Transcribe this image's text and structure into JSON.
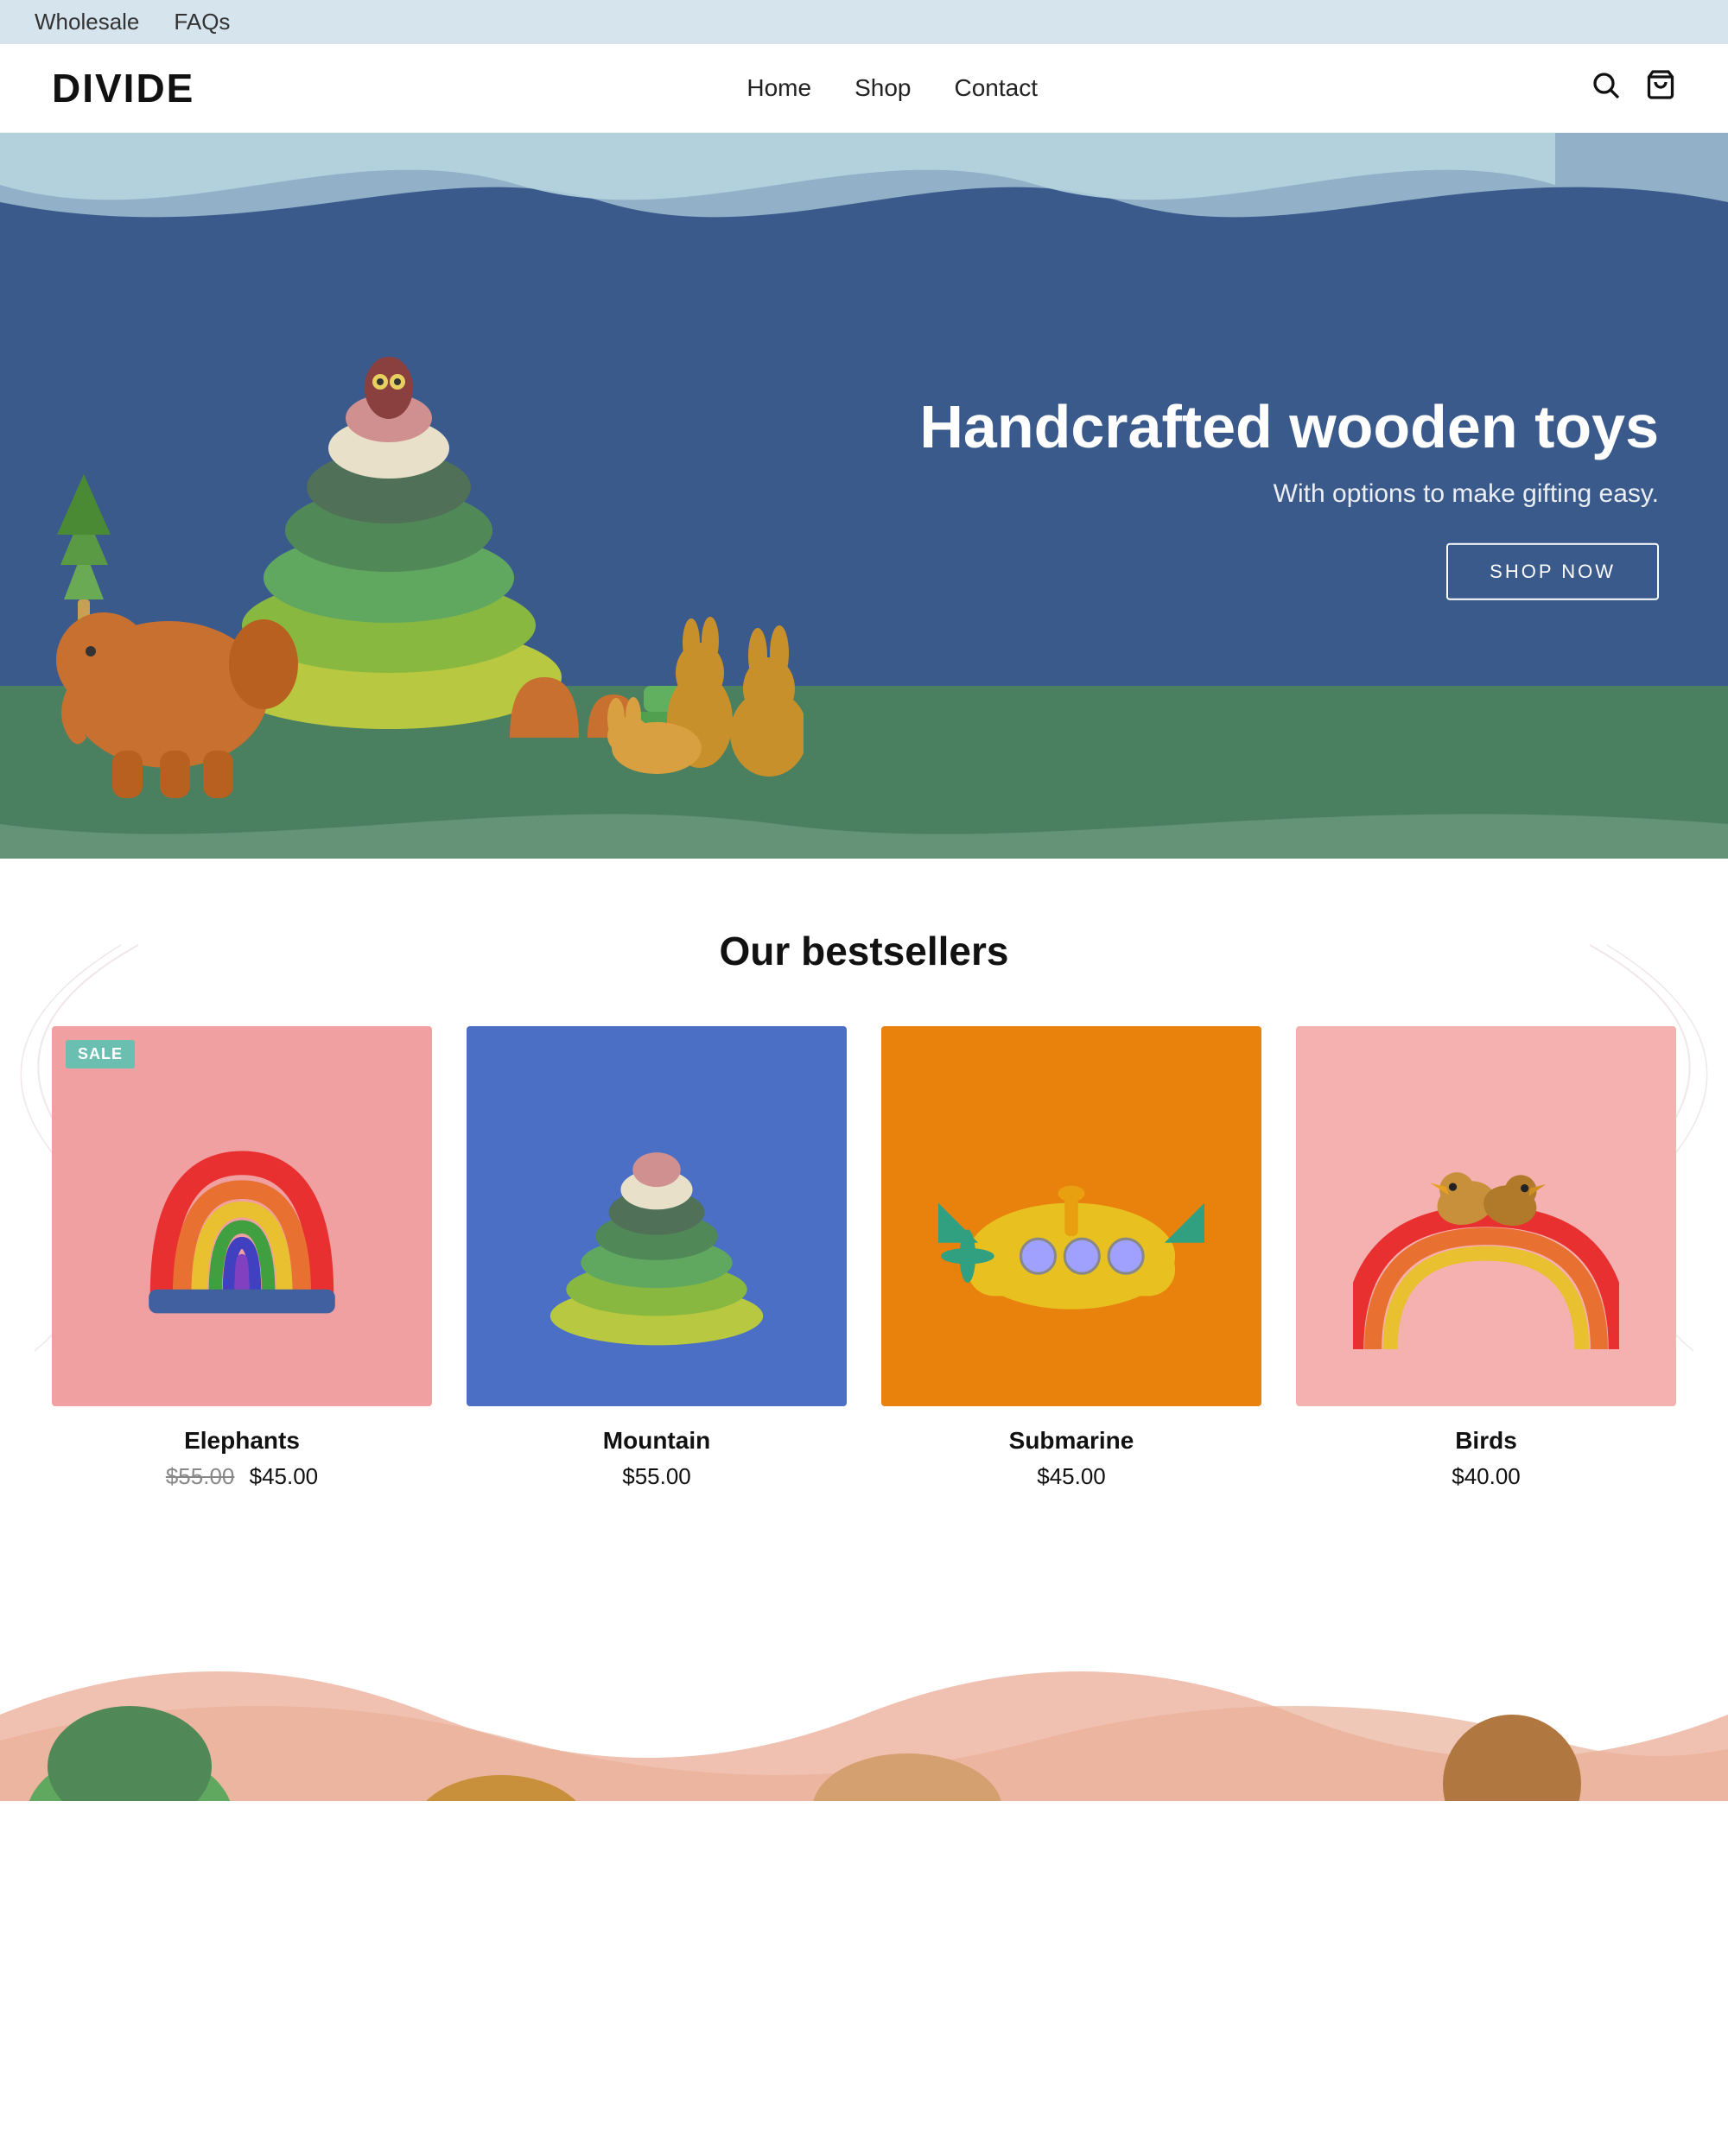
{
  "topbar": {
    "links": [
      {
        "label": "Wholesale",
        "href": "#"
      },
      {
        "label": "FAQs",
        "href": "#"
      }
    ]
  },
  "header": {
    "logo": "DIVIDE",
    "nav": [
      {
        "label": "Home",
        "href": "#"
      },
      {
        "label": "Shop",
        "href": "#"
      },
      {
        "label": "Contact",
        "href": "#"
      }
    ],
    "search_label": "Search",
    "cart_label": "Cart"
  },
  "hero": {
    "title": "Handcrafted wooden toys",
    "subtitle": "With options to make gifting easy.",
    "cta": "SHOP NOW",
    "bg_color": "#3a5a8c"
  },
  "bestsellers": {
    "section_title": "Our bestsellers",
    "products": [
      {
        "name": "Elephants",
        "price_original": "$55.00",
        "price_sale": "$45.00",
        "on_sale": true,
        "bg_color": "#f0a0a0"
      },
      {
        "name": "Mountain",
        "price": "$55.00",
        "on_sale": false,
        "bg_color": "#4a6fc4"
      },
      {
        "name": "Submarine",
        "price": "$45.00",
        "on_sale": false,
        "bg_color": "#e8820c"
      },
      {
        "name": "Birds",
        "price": "$40.00",
        "on_sale": false,
        "bg_color": "#f5b0b0"
      }
    ],
    "sale_label": "SALE"
  },
  "colors": {
    "header_bg": "#fff",
    "topbar_bg": "#d6e4ed",
    "hero_bg": "#3a5a8c",
    "green_surface": "#3a7a5a",
    "accent_teal": "#6bbfb0"
  }
}
